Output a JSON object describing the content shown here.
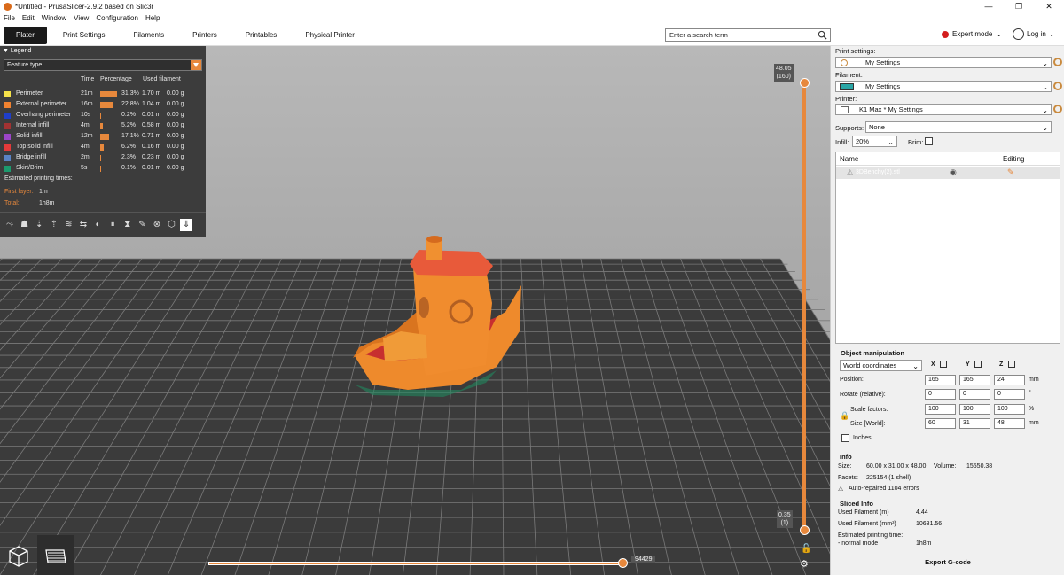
{
  "window": {
    "title": "*Untitled - PrusaSlicer-2.9.2 based on Slic3r",
    "controls": [
      "—",
      "❐",
      "✕"
    ]
  },
  "menu": [
    "File",
    "Edit",
    "Window",
    "View",
    "Configuration",
    "Help"
  ],
  "tabs": [
    {
      "label": "Plater",
      "active": true
    },
    {
      "label": "Print Settings"
    },
    {
      "label": "Filaments"
    },
    {
      "label": "Printers"
    },
    {
      "label": "Printables"
    },
    {
      "label": "Physical Printer"
    }
  ],
  "search": {
    "placeholder": "Enter a search term"
  },
  "mode": {
    "label": "Expert mode",
    "color": "#d31d1d"
  },
  "login": {
    "label": "Log in"
  },
  "legend": {
    "title": "Legend",
    "view_type": "Feature type",
    "columns": {
      "time": "Time",
      "percentage": "Percentage",
      "filament": "Used filament"
    },
    "features": [
      {
        "name": "Perimeter",
        "color": "#f5e24a",
        "time": "21m",
        "pct": "31.3%",
        "pct_value": 31.3,
        "len": "1.70 m",
        "weight": "0.00 g"
      },
      {
        "name": "External perimeter",
        "color": "#f08230",
        "time": "16m",
        "pct": "22.8%",
        "pct_value": 22.8,
        "len": "1.04 m",
        "weight": "0.00 g"
      },
      {
        "name": "Overhang perimeter",
        "color": "#1f3ec9",
        "time": "10s",
        "pct": "0.2%",
        "pct_value": 0.2,
        "len": "0.01 m",
        "weight": "0.00 g"
      },
      {
        "name": "Internal infill",
        "color": "#a23232",
        "time": "4m",
        "pct": "5.2%",
        "pct_value": 5.2,
        "len": "0.58 m",
        "weight": "0.00 g"
      },
      {
        "name": "Solid infill",
        "color": "#9b45c8",
        "time": "12m",
        "pct": "17.1%",
        "pct_value": 17.1,
        "len": "0.71 m",
        "weight": "0.00 g"
      },
      {
        "name": "Top solid infill",
        "color": "#e33a3a",
        "time": "4m",
        "pct": "6.2%",
        "pct_value": 6.2,
        "len": "0.16 m",
        "weight": "0.00 g"
      },
      {
        "name": "Bridge infill",
        "color": "#5a83c4",
        "time": "2m",
        "pct": "2.3%",
        "pct_value": 2.3,
        "len": "0.23 m",
        "weight": "0.00 g"
      },
      {
        "name": "Skirt/Brim",
        "color": "#1c9a6e",
        "time": "5s",
        "pct": "0.1%",
        "pct_value": 0.1,
        "len": "0.01 m",
        "weight": "0.00 g"
      }
    ],
    "estimated_title": "Estimated printing times:",
    "first_layer_label": "First layer:",
    "first_layer_value": "1m",
    "total_label": "Total:",
    "total_value": "1h8m"
  },
  "sliders": {
    "top_value": "48.05",
    "top_layer": "(160)",
    "bottom_value": "0.35",
    "bottom_layer": "(1)",
    "horizontal_value": "94429"
  },
  "right": {
    "print_settings_label": "Print settings:",
    "print_settings_value": "My Settings",
    "filament_label": "Filament:",
    "filament_value": "My Settings",
    "filament_color": "#2aa6a6",
    "printer_label": "Printer:",
    "printer_value": "K1 Max * My Settings",
    "supports_label": "Supports:",
    "supports_value": "None",
    "infill_label": "Infill:",
    "infill_value": "20%",
    "brim_label": "Brim:",
    "list_name_header": "Name",
    "list_editing_header": "Editing",
    "object_name": "3DBenchy(2).stl",
    "obj_manip_title": "Object manipulation",
    "coord_system": "World coordinates",
    "axes": [
      "X",
      "Y",
      "Z"
    ],
    "position_label": "Position:",
    "position": [
      "165",
      "165",
      "24"
    ],
    "position_unit": "mm",
    "rotate_label": "Rotate (relative):",
    "rotate": [
      "0",
      "0",
      "0"
    ],
    "rotate_unit": "°",
    "scale_label": "Scale factors:",
    "scale": [
      "100",
      "100",
      "100"
    ],
    "scale_unit": "%",
    "size_label": "Size [World]:",
    "size": [
      "60",
      "31",
      "48"
    ],
    "size_unit": "mm",
    "inches_label": "Inches",
    "info_title": "Info",
    "size_info_label": "Size:",
    "size_info_value": "60.00 x 31.00 x 48.00",
    "volume_label": "Volume:",
    "volume_value": "15550.38",
    "facets_label": "Facets:",
    "facets_value": "225154 (1 shell)",
    "repaired": "Auto-repaired 1104 errors",
    "sliced_title": "Sliced Info",
    "used_fil_m_label": "Used Filament (m)",
    "used_fil_m_value": "4.44",
    "used_fil_mm3_label": "Used Filament (mm³)",
    "used_fil_mm3_value": "10681.56",
    "est_time_label": "Estimated printing time:",
    "normal_mode_label": "- normal mode",
    "normal_mode_value": "1h8m",
    "export_label": "Export G-code"
  }
}
